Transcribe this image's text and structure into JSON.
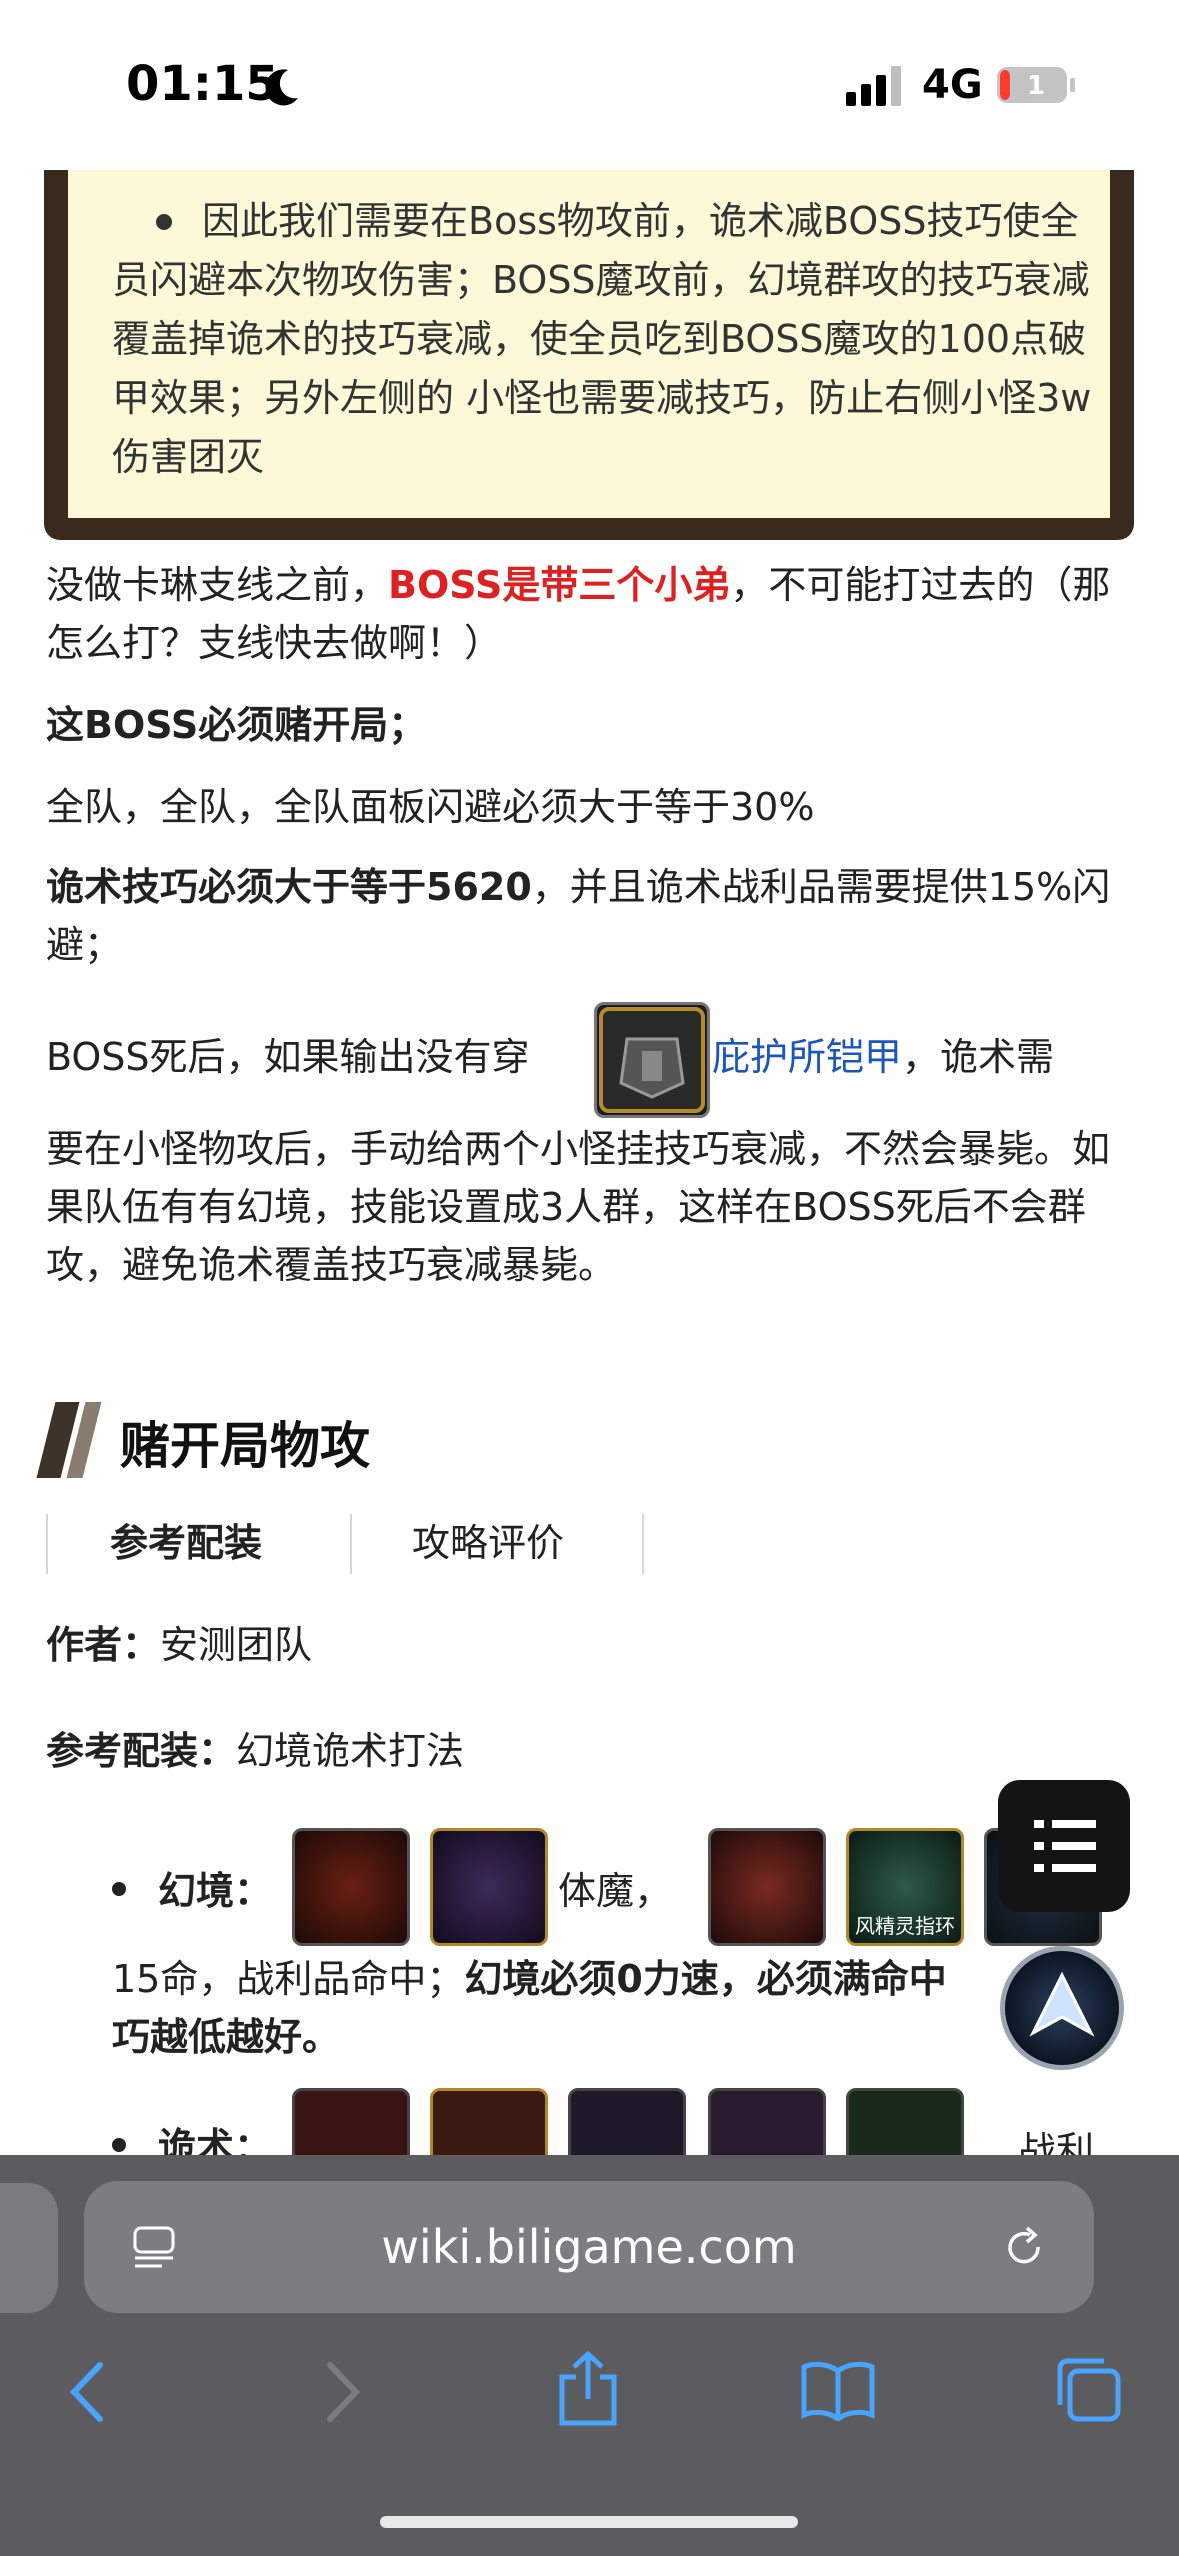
{
  "status_bar": {
    "time": "01:15",
    "network": "4G",
    "battery": "1"
  },
  "note": {
    "text": "因此我们需要在Boss物攻前，诡术减BOSS技巧使全员闪避本次物攻伤害；BOSS魔攻前，幻境群攻的技巧衰减覆盖掉诡术的技巧衰减，使全员吃到BOSS魔攻的100点破甲效果；另外左侧的 小怪也需要减技巧，防止右侧小怪3w伤害团灭"
  },
  "paragraphs": {
    "p1_before": "没做卡琳支线之前，",
    "p1_red": "BOSS是带三个小弟",
    "p1_after": "，不可能打过去的（那怎么打？支线快去做啊！）",
    "p2": "这BOSS必须赌开局；",
    "p3": "全队，全队，全队面板闪避必须大于等于30%",
    "p4_bold": "诡术技巧必须大于等于5620",
    "p4_rest": "，并且诡术战利品需要提供15%闪避；",
    "p5_before": "BOSS死后，如果输出没有穿",
    "p5_link": "庇护所铠甲",
    "p5_after1": "，诡术需",
    "p5_rest": "要在小怪物攻后，手动给两个小怪挂技巧衰减，不然会暴毙。如果队伍有有幻境，技能设置成3人群，这样在BOSS死后不会群攻，避免诡术覆盖技巧衰减暴毙。"
  },
  "section": {
    "title": "赌开局物攻",
    "tabs": [
      "参考配装",
      "攻略评价"
    ],
    "author_label": "作者：",
    "author_value": "安测团队",
    "config_label": "参考配装：",
    "config_value": "幻境诡术打法"
  },
  "equip": {
    "illusion_label": "幻境：",
    "illusion_mid": "体魔，",
    "ring_caption": "风精灵指环",
    "illusion_line2": "15命，战利品命中；",
    "illusion_line2_bold": "幻境必须0力速，必须满命中",
    "illusion_line3_bold": "巧越低越好。",
    "trick_label": "诡术：",
    "trick_tail": "战利"
  },
  "browser": {
    "url": "wiki.biligame.com"
  },
  "icons": [
    "moon-icon",
    "signal-icon",
    "battery-icon",
    "reader-icon",
    "reload-icon",
    "back-icon",
    "forward-icon",
    "share-icon",
    "bookmarks-icon",
    "tabs-icon",
    "toc-icon",
    "top-icon"
  ]
}
